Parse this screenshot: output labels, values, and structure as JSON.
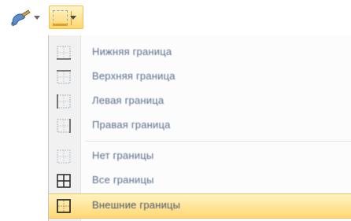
{
  "toolbar": {
    "brush_icon": "paint-brush-icon",
    "border_icon": "bottom-border-icon",
    "dropdown_icon": "chevron-down-icon"
  },
  "menu": {
    "items": [
      {
        "label": "Нижняя граница",
        "icon": "border-bottom-icon"
      },
      {
        "label": "Верхняя граница",
        "icon": "border-top-icon"
      },
      {
        "label": "Левая граница",
        "icon": "border-left-icon"
      },
      {
        "label": "Правая граница",
        "icon": "border-right-icon"
      },
      {
        "label": "Нет границы",
        "icon": "no-border-icon"
      },
      {
        "label": "Все границы",
        "icon": "all-borders-icon"
      },
      {
        "label": "Внешние границы",
        "icon": "outside-borders-icon"
      }
    ],
    "highlight_color": "#ffd873",
    "text_color": "#5a6f8c"
  }
}
